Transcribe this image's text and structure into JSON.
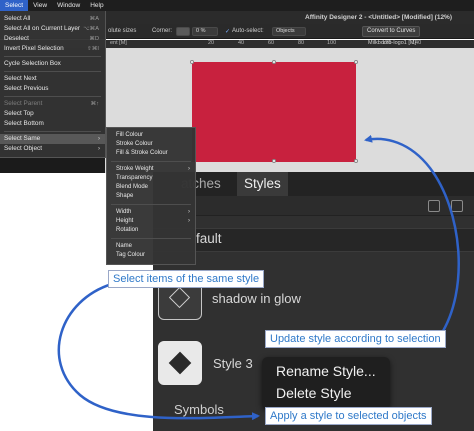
{
  "menubar": {
    "items": [
      "Select",
      "View",
      "Window",
      "Help"
    ]
  },
  "app": {
    "title": "Affinity Designer 2 - <Untitled> [Modified] (12%)"
  },
  "toolbar": {
    "scale_label": "olute sizes",
    "corner_label": "Corner:",
    "corner_value": "0 %",
    "auto_select_label": "Auto-select:",
    "auto_select_value": "Objects",
    "convert_button": "Convert to Curves"
  },
  "ruler": {
    "unit_left": "nt [M]",
    "unit_right": "ent [M]",
    "tab_name": "Milkbomb-logo1 [M]",
    "ticks": [
      "20",
      "40",
      "60",
      "80",
      "100",
      "120",
      "140"
    ]
  },
  "select_menu": {
    "items": [
      {
        "label": "Select All",
        "shortcut": "⌘A",
        "type": "item"
      },
      {
        "label": "Select All on Current Layer",
        "shortcut": "⌥⌘A",
        "type": "item"
      },
      {
        "label": "Deselect",
        "shortcut": "⌘D",
        "type": "item"
      },
      {
        "label": "Invert Pixel Selection",
        "shortcut": "⇧⌘I",
        "type": "item"
      },
      {
        "type": "sep"
      },
      {
        "label": "Cycle Selection Box",
        "shortcut": "",
        "type": "item"
      },
      {
        "type": "sep"
      },
      {
        "label": "Select Next",
        "shortcut": "",
        "type": "item"
      },
      {
        "label": "Select Previous",
        "shortcut": "",
        "type": "item"
      },
      {
        "type": "sep"
      },
      {
        "label": "Select Parent",
        "shortcut": "⌘↑",
        "type": "disabled"
      },
      {
        "label": "Select Top",
        "shortcut": "",
        "type": "item"
      },
      {
        "label": "Select Bottom",
        "shortcut": "",
        "type": "item"
      },
      {
        "type": "sep"
      },
      {
        "label": "Select Same",
        "shortcut": "",
        "type": "submenu-open"
      },
      {
        "label": "Select Object",
        "shortcut": "",
        "type": "submenu"
      }
    ]
  },
  "select_same_submenu": {
    "items": [
      {
        "label": "Fill Colour",
        "type": "item"
      },
      {
        "label": "Stroke Colour",
        "type": "item"
      },
      {
        "label": "Fill & Stroke Colour",
        "type": "item"
      },
      {
        "type": "sep"
      },
      {
        "label": "Stroke Weight",
        "type": "submenu"
      },
      {
        "label": "Transparency",
        "type": "item"
      },
      {
        "label": "Blend Mode",
        "type": "item"
      },
      {
        "label": "Shape",
        "type": "item"
      },
      {
        "type": "sep"
      },
      {
        "label": "Width",
        "type": "submenu"
      },
      {
        "label": "Height",
        "type": "submenu"
      },
      {
        "label": "Rotation",
        "type": "item"
      },
      {
        "type": "sep"
      },
      {
        "label": "Name",
        "type": "item"
      },
      {
        "label": "Tag Colour",
        "type": "item"
      }
    ]
  },
  "styles_panel": {
    "tabs": [
      "atches",
      "Styles"
    ],
    "category_dropdown": "fault",
    "styles": [
      "shadow in glow",
      "Style 3"
    ],
    "bottom_tab": "Symbols"
  },
  "context_menu": {
    "items": [
      "Rename Style...",
      "Delete Style"
    ]
  },
  "annotations": {
    "select_same": "Select items of the same style",
    "update_style": "Update style according to selection",
    "apply_style": "Apply a style to selected objects"
  },
  "colors": {
    "rect_fill": "#c8213e",
    "annotation_blue": "#2f62c8",
    "annotation_text": "#2f79c9"
  }
}
